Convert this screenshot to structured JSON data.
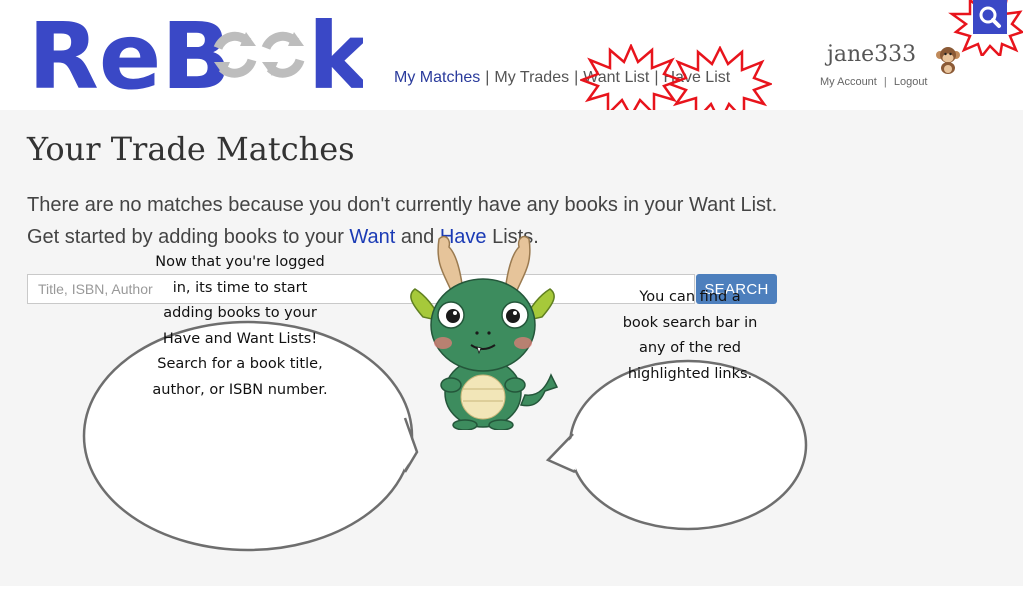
{
  "header": {
    "logo": {
      "text_prefix": "ReB",
      "text_suffix": "k",
      "alt": "ReBook"
    },
    "nav": {
      "my_matches": "My Matches",
      "separator": "|",
      "my_trades": "My Trades",
      "want_list": "Want List",
      "have_list": "Have List"
    },
    "user": {
      "username": "jane333",
      "my_account": "My Account",
      "separator": "|",
      "logout": "Logout"
    },
    "search_icon": "search-icon"
  },
  "main": {
    "title": "Your Trade Matches",
    "message_line1": "There are no matches because you don't currently have any books in your Want List.",
    "message_line2_start": "Get started by adding books to your ",
    "want_link": "Want",
    "message_line2_mid": " and ",
    "have_link": "Have",
    "message_line2_end": " Lists.",
    "search": {
      "placeholder": "Title, ISBN, Author",
      "button": "SEARCH"
    },
    "bubble_left": [
      "Now that you're logged",
      "in, its time to start",
      "adding books to your",
      "Have and Want Lists!",
      "Search for a book title,",
      "author, or ISBN number."
    ],
    "bubble_right": [
      "You can find a",
      "book search bar in",
      "any of the red",
      "highlighted links."
    ]
  },
  "colors": {
    "brand_blue": "#3a48c6",
    "nav_active": "#2a3b9c",
    "highlight_red": "#e8141c",
    "button_blue": "#4d7fbd",
    "link_blue": "#1b3bb5",
    "dragon_green": "#3d8c5e"
  }
}
